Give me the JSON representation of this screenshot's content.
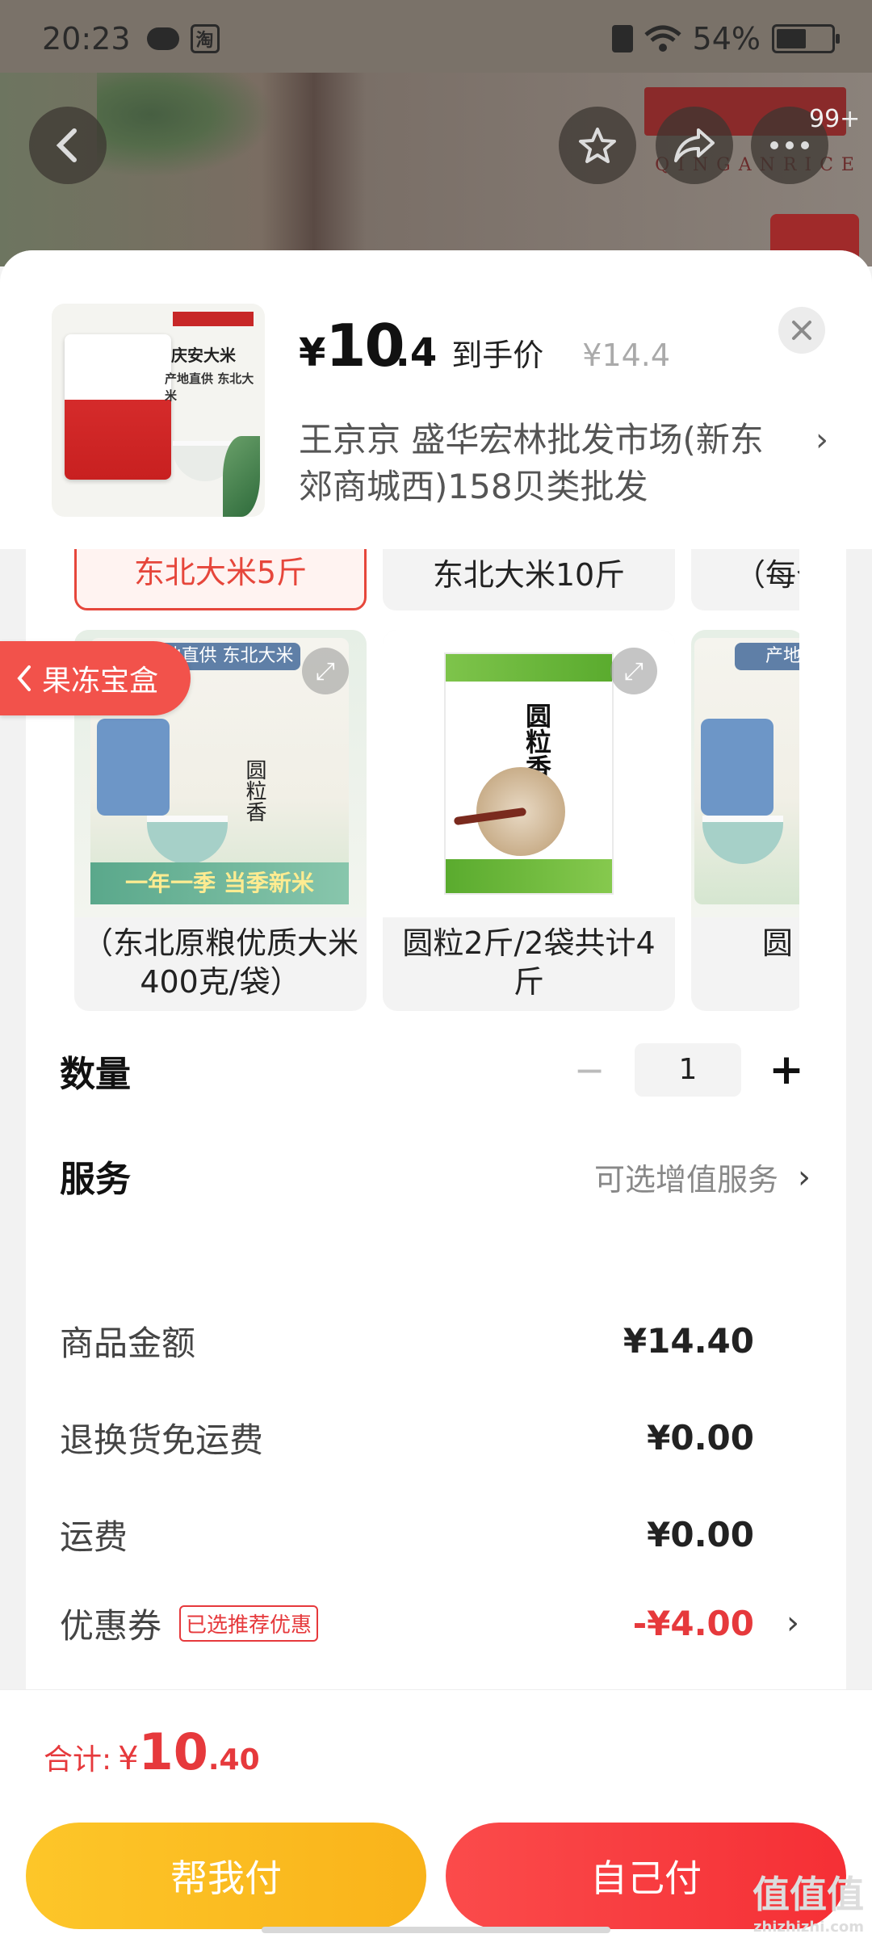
{
  "status_bar": {
    "time": "20:23",
    "app_badge": "淘",
    "battery": "54%",
    "battery_level": 0.54
  },
  "background": {
    "brand_sub": "QINGANRICE",
    "more_badge": "99+"
  },
  "sheet": {
    "price": {
      "symbol": "¥",
      "integer": "10",
      "decimal": ".4",
      "tag": "到手价",
      "original": "¥14.4"
    },
    "shop_name": "王京京 盛华宏林批发市场(新东郊商城西)158贝类批发",
    "thumb": {
      "title": "庆安大米",
      "subtitle": "产地直供 东北大米"
    }
  },
  "variants": {
    "options": [
      {
        "label": "东北大米5斤",
        "selected": true
      },
      {
        "label": "东北大米10斤",
        "selected": false
      },
      {
        "label": "（每个",
        "selected": false
      }
    ],
    "products": [
      {
        "label": "（东北原粮优质大米400克/袋）",
        "ribbon": "产地直供 东北大米",
        "bag_title": "圆粒香",
        "band": "一年一季 当季新米"
      },
      {
        "label": "圆粒2斤/2袋共计4斤",
        "bag_title": "圆粒香"
      },
      {
        "label": "圆",
        "ribbon": "产地"
      }
    ],
    "floating_tag": "果冻宝盒"
  },
  "quantity": {
    "label": "数量",
    "value": "1"
  },
  "service": {
    "label": "服务",
    "value": "可选增值服务"
  },
  "summary": {
    "rows": [
      {
        "label": "商品金额",
        "value": "¥14.40"
      },
      {
        "label": "退换货免运费",
        "value": "¥0.00"
      },
      {
        "label": "运费",
        "value": "¥0.00"
      },
      {
        "label": "优惠券",
        "tag": "已选推荐优惠",
        "value": "-¥4.00"
      }
    ]
  },
  "footer": {
    "total_label": "合计:",
    "total_symbol": "¥",
    "total_int": "10",
    "total_dec": ".40",
    "help_pay": "帮我付",
    "self_pay": "自己付"
  },
  "watermark": {
    "main": "值值值",
    "sub": "zhizhizhi.com"
  },
  "colors": {
    "accent_red": "#e6393c",
    "pay_yellow": "#fdc629",
    "pay_red": "#f52f35"
  },
  "icons": [
    "back-icon",
    "star-icon",
    "share-icon",
    "more-icon",
    "close-icon",
    "expand-icon",
    "chevron-right-icon",
    "minus-icon",
    "plus-icon"
  ]
}
